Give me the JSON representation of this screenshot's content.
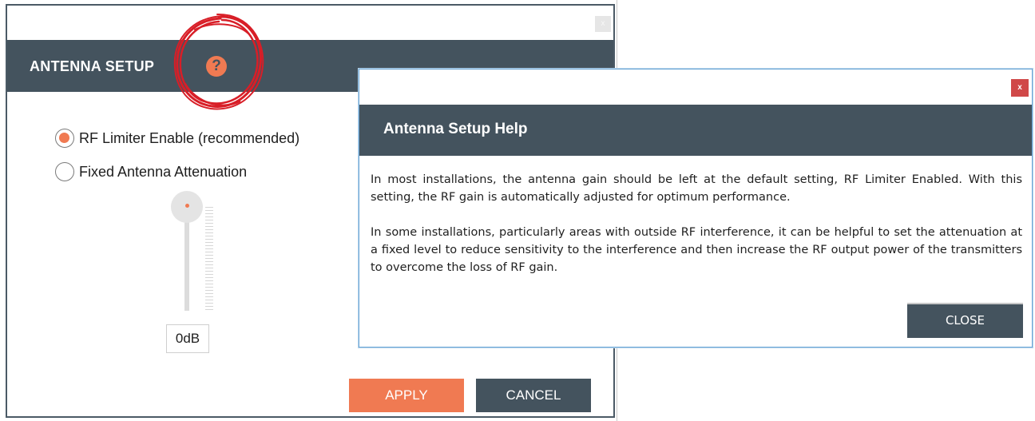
{
  "main_dialog": {
    "title": "ANTENNA SETUP",
    "help_icon": "?",
    "close_label": "x",
    "radio_options": [
      {
        "label": "RF Limiter Enable (recommended)",
        "checked": true
      },
      {
        "label": "Fixed Antenna Attenuation",
        "checked": false
      }
    ],
    "attenuation_value": "0dB",
    "attenuation_level": 0,
    "apply_label": "APPLY",
    "cancel_label": "CANCEL"
  },
  "help_dialog": {
    "title": "Antenna Setup Help",
    "close_x": "x",
    "paragraphs": [
      "In most installations, the antenna gain should be left at the default setting, RF Limiter Enabled. With this setting, the RF gain is automatically adjusted for optimum performance.",
      "In some installations, particularly areas with outside RF interference, it can be helpful to set the attenuation at a fixed level to reduce sensitivity to the interference and then increase the RF output power of the transmitters to overcome the loss of RF gain."
    ],
    "close_button": "CLOSE"
  },
  "colors": {
    "header": "#44535e",
    "accent": "#f07a52",
    "close_red": "#d04848",
    "annotation_red": "#d81e27"
  }
}
